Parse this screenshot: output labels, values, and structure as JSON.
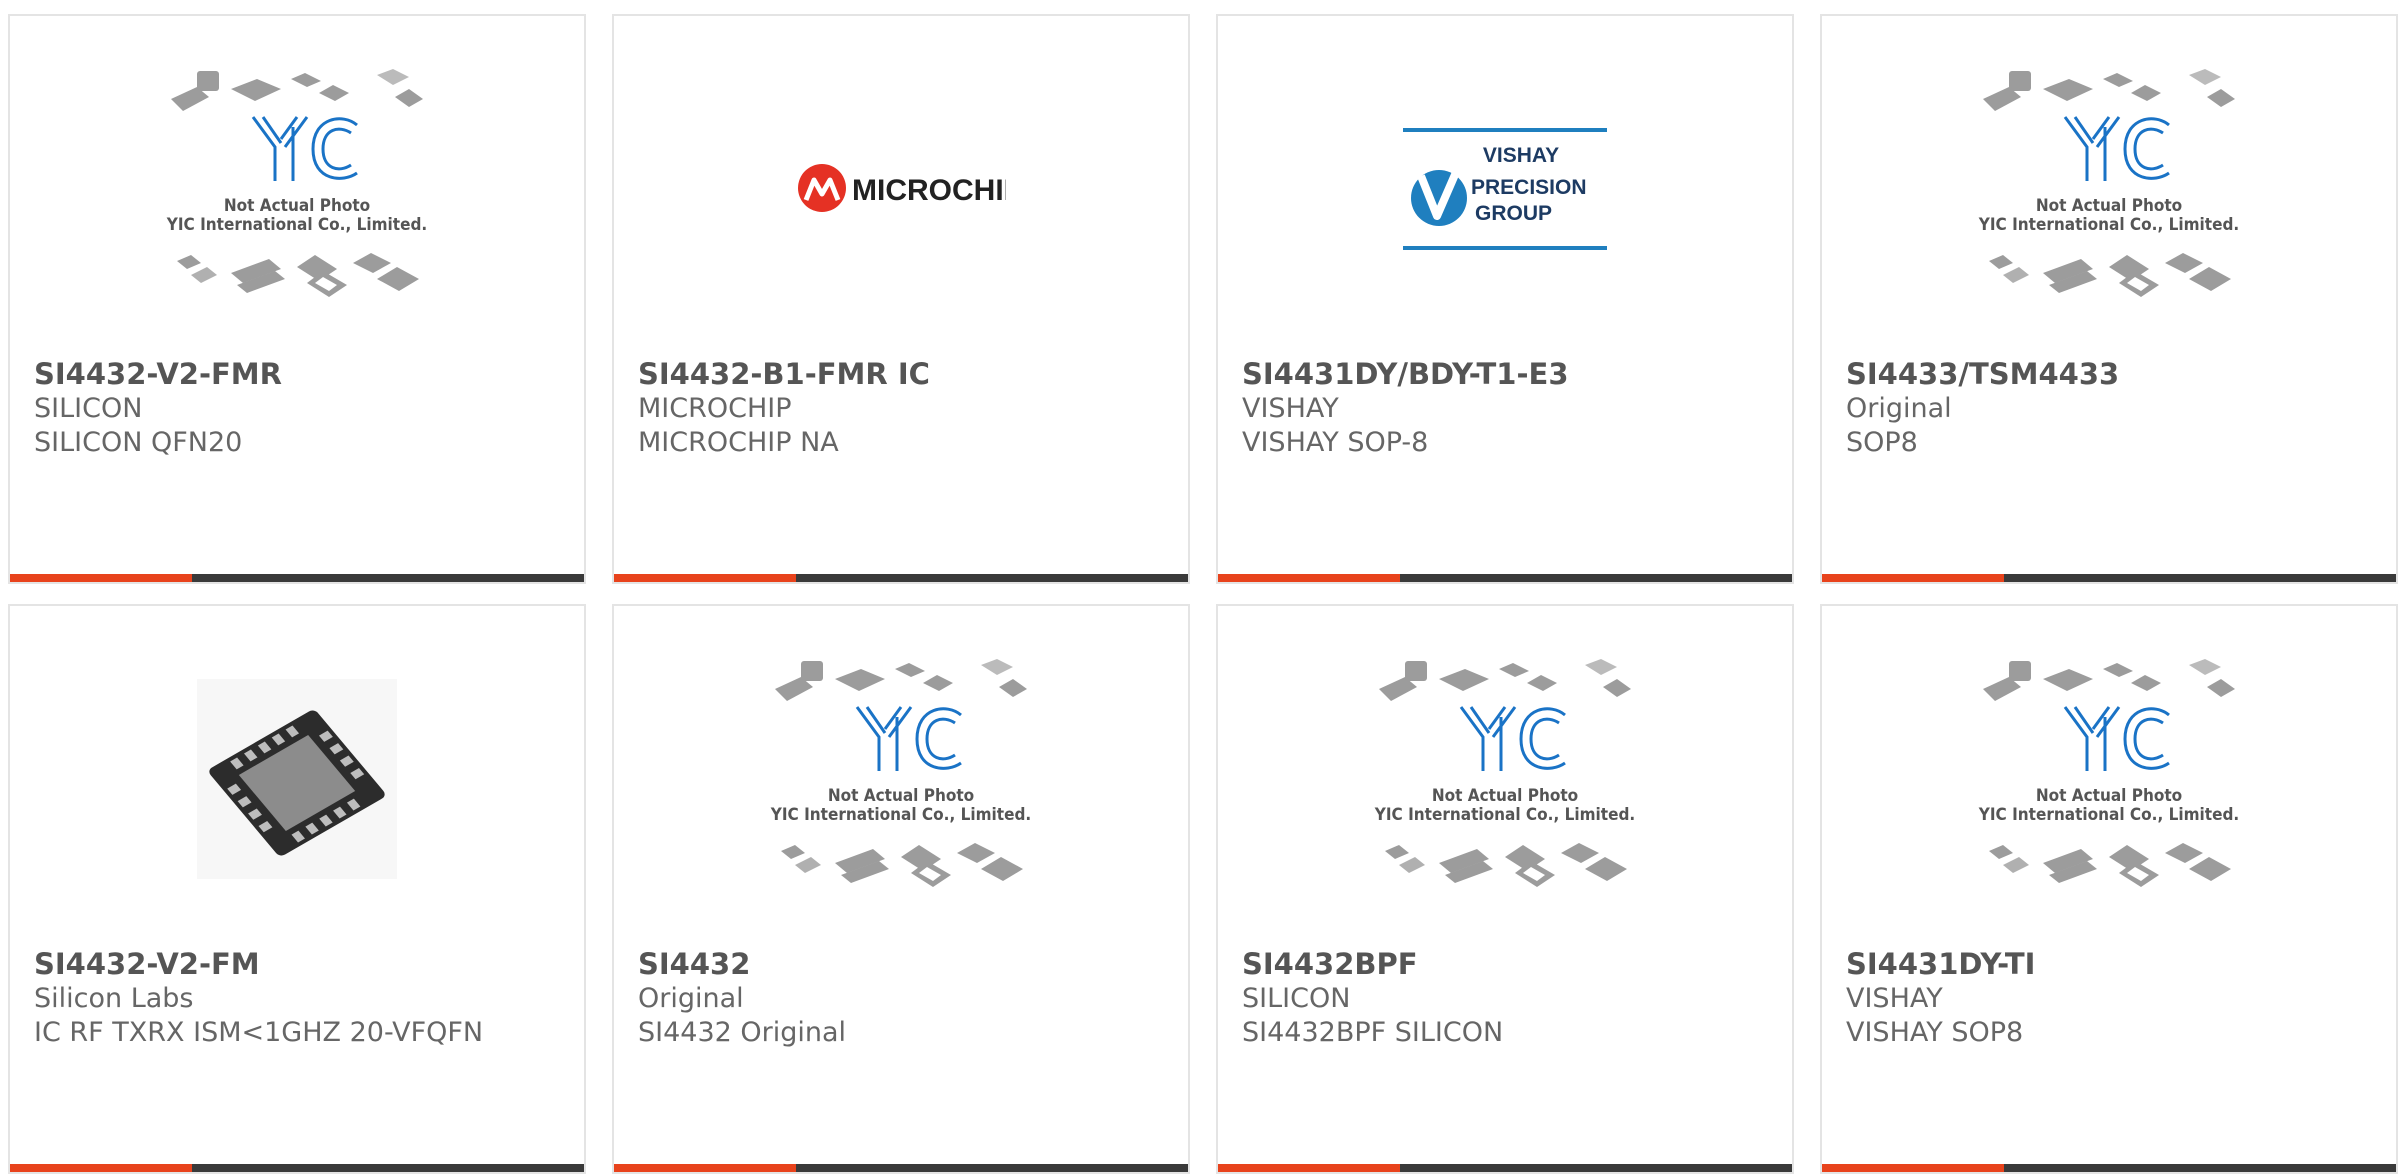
{
  "colors": {
    "accent": "#e8431c",
    "bar_dark": "#3a3a3a",
    "card_border": "#e4e4e4",
    "part_number_text": "#555555",
    "secondary_text": "#666666",
    "microchip_red": "#e53124",
    "vishay_blue": "#1f7fbf"
  },
  "placeholder": {
    "line1": "Not Actual Photo",
    "line2": "YIC International Co., Limited.",
    "logo_text": "YIC"
  },
  "products": [
    {
      "part_number": "SI4432-V2-FMR",
      "brand": "SILICON",
      "description": "SILICON QFN20",
      "image": "yic-placeholder"
    },
    {
      "part_number": "SI4432-B1-FMR IC",
      "brand": "MICROCHIP",
      "description": "MICROCHIP NA",
      "image": "microchip-logo",
      "logo_text": "MICROCHIP"
    },
    {
      "part_number": "SI4431DY/BDY-T1-E3",
      "brand": "VISHAY",
      "description": "VISHAY SOP-8",
      "image": "vishay-logo",
      "logo_lines": [
        "VISHAY",
        "PRECISION",
        "GROUP"
      ]
    },
    {
      "part_number": "SI4433/TSM4433",
      "brand": "Original",
      "description": "SOP8",
      "image": "yic-placeholder"
    },
    {
      "part_number": "SI4432-V2-FM",
      "brand": "Silicon Labs",
      "description": "IC RF TXRX ISM<1GHZ 20-VFQFN",
      "image": "qfn-chip-photo"
    },
    {
      "part_number": "SI4432",
      "brand": "Original",
      "description": "SI4432 Original",
      "image": "yic-placeholder"
    },
    {
      "part_number": "SI4432BPF",
      "brand": "SILICON",
      "description": "SI4432BPF SILICON",
      "image": "yic-placeholder"
    },
    {
      "part_number": "SI4431DY-TI",
      "brand": "VISHAY",
      "description": "VISHAY SOP8",
      "image": "yic-placeholder"
    }
  ]
}
